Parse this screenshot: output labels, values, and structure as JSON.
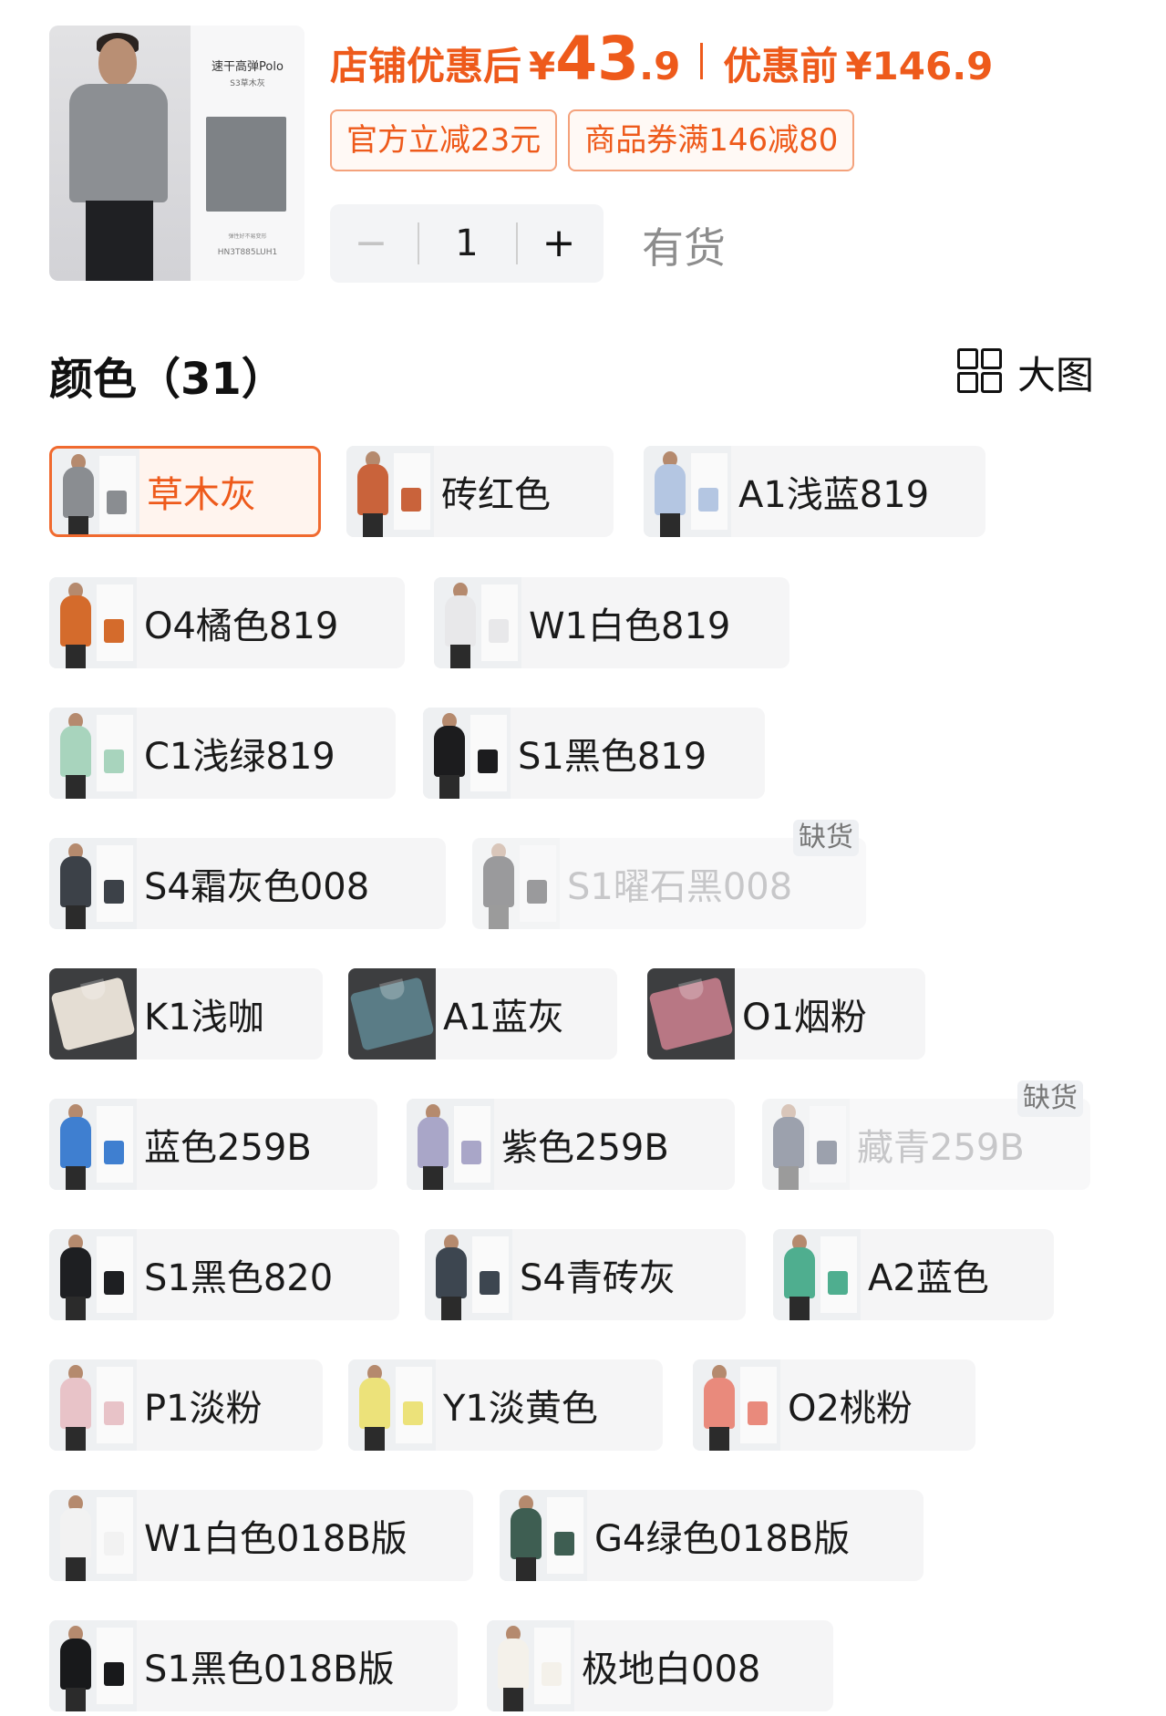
{
  "product": {
    "thumbnail": {
      "card_title": "速干高弹Polo",
      "card_subtitle": "S3草木灰",
      "card_note": "弹性好不易变形",
      "card_code": "HN3T885LUH1"
    },
    "price_label": "店铺优惠后",
    "currency": "¥",
    "price_integer": "43",
    "price_decimal": ".9",
    "original_label": "优惠前",
    "original_price": "¥146.9",
    "tags": [
      "官方立减23元",
      "商品券满146减80"
    ],
    "quantity": "1",
    "minus_label": "−",
    "plus_label": "+",
    "stock_status": "有货"
  },
  "color_section": {
    "title": "颜色（31）",
    "view_toggle_label": "大图",
    "out_of_stock_label": "缺货"
  },
  "colors": [
    {
      "label": "草木灰",
      "state": "selected",
      "tone": "#8a8d91",
      "kind": "model"
    },
    {
      "label": "砖红色",
      "state": "normal",
      "tone": "#c9633b",
      "kind": "model"
    },
    {
      "label": "A1浅蓝819",
      "state": "normal",
      "tone": "#b4c6e2",
      "kind": "model"
    },
    {
      "label": "O4橘色819",
      "state": "normal",
      "tone": "#d46b2c",
      "kind": "model"
    },
    {
      "label": "W1白色819",
      "state": "normal",
      "tone": "#e8e8ea",
      "kind": "model"
    },
    {
      "label": "C1浅绿819",
      "state": "normal",
      "tone": "#a8d4bd",
      "kind": "model"
    },
    {
      "label": "S1黑色819",
      "state": "normal",
      "tone": "#1c1c1e",
      "kind": "model"
    },
    {
      "label": "S4霜灰色008",
      "state": "normal",
      "tone": "#3c4148",
      "kind": "model"
    },
    {
      "label": "S1曜石黑008",
      "state": "disabled",
      "tone": "#2a2a2c",
      "kind": "model"
    },
    {
      "label": "K1浅咖",
      "state": "normal",
      "tone": "#e4ddd3",
      "kind": "fold"
    },
    {
      "label": "A1蓝灰",
      "state": "normal",
      "tone": "#5a7c86",
      "kind": "fold"
    },
    {
      "label": "O1烟粉",
      "state": "normal",
      "tone": "#b87784",
      "kind": "fold"
    },
    {
      "label": "蓝色259B",
      "state": "normal",
      "tone": "#3f7fd0",
      "kind": "model"
    },
    {
      "label": "紫色259B",
      "state": "normal",
      "tone": "#a9a6c8",
      "kind": "model"
    },
    {
      "label": "藏青259B",
      "state": "disabled",
      "tone": "#2f3a52",
      "kind": "model"
    },
    {
      "label": "S1黑色820",
      "state": "normal",
      "tone": "#1e1f22",
      "kind": "model"
    },
    {
      "label": "S4青砖灰",
      "state": "normal",
      "tone": "#3d4650",
      "kind": "model"
    },
    {
      "label": "A2蓝色",
      "state": "normal",
      "tone": "#4fae8f",
      "kind": "model"
    },
    {
      "label": "P1淡粉",
      "state": "normal",
      "tone": "#e8c3c8",
      "kind": "model"
    },
    {
      "label": "Y1淡黄色",
      "state": "normal",
      "tone": "#ece27a",
      "kind": "model"
    },
    {
      "label": "O2桃粉",
      "state": "normal",
      "tone": "#e98a7c",
      "kind": "model"
    },
    {
      "label": "W1白色018B版",
      "state": "normal",
      "tone": "#f2f2f2",
      "kind": "model"
    },
    {
      "label": "G4绿色018B版",
      "state": "normal",
      "tone": "#3e5e52",
      "kind": "model"
    },
    {
      "label": "S1黑色018B版",
      "state": "normal",
      "tone": "#18191b",
      "kind": "model"
    },
    {
      "label": "极地白008",
      "state": "normal",
      "tone": "#f4f1ea",
      "kind": "model"
    }
  ]
}
